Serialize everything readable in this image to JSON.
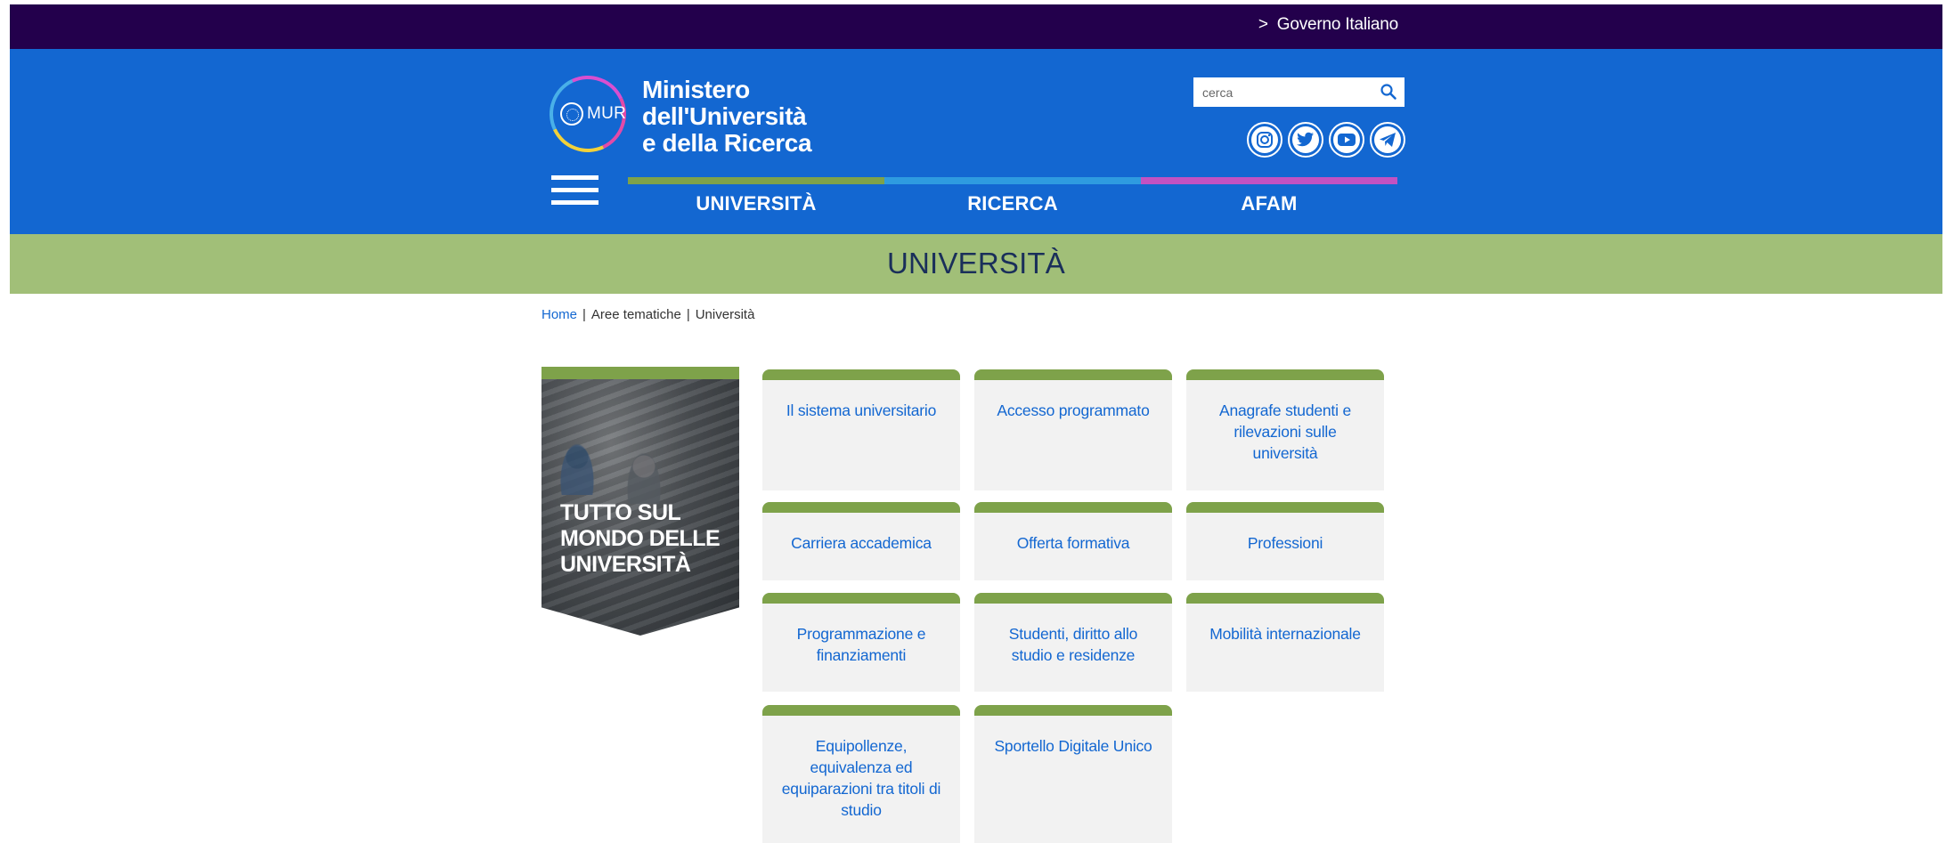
{
  "topbar": {
    "link_label": "Governo Italiano",
    "chevron": ">"
  },
  "header": {
    "logo_text": "MUR",
    "ministry_name_line1": "Ministero",
    "ministry_name_line2": "dell'Università",
    "ministry_name_line3": "e della Ricerca",
    "search": {
      "placeholder": "cerca",
      "icon": "search-icon"
    },
    "social": [
      {
        "name": "instagram-icon"
      },
      {
        "name": "twitter-icon"
      },
      {
        "name": "youtube-icon"
      },
      {
        "name": "telegram-icon"
      }
    ],
    "nav": [
      {
        "label": "UNIVERSITÀ",
        "color": "#7ea24a"
      },
      {
        "label": "RICERCA",
        "color": "#2e9be0"
      },
      {
        "label": "AFAM",
        "color": "#c252c2"
      }
    ]
  },
  "banner": {
    "title": "UNIVERSITÀ"
  },
  "breadcrumb": {
    "home": "Home",
    "separator": "|",
    "item2": "Aree tematiche",
    "item3": "Università"
  },
  "hero": {
    "title_line1": "TUTTO SUL",
    "title_line2": "MONDO DELLE",
    "title_line3": "UNIVERSITÀ"
  },
  "tiles": [
    {
      "label": "Il sistema universitario"
    },
    {
      "label": "Accesso programmato"
    },
    {
      "label": "Anagrafe studenti e rilevazioni sulle università"
    },
    {
      "label": "Carriera accademica"
    },
    {
      "label": "Offerta formativa"
    },
    {
      "label": "Professioni"
    },
    {
      "label": "Programmazione e finanziamenti"
    },
    {
      "label": "Studenti, diritto allo studio e residenze"
    },
    {
      "label": "Mobilità internazionale"
    },
    {
      "label": "Equipollenze, equivalenza ed equiparazioni tra titoli di studio"
    },
    {
      "label": "Sportello Digitale Unico"
    }
  ],
  "colors": {
    "topbar": "#23004c",
    "header": "#1367d1",
    "banner": "#a1bf78",
    "tile_accent": "#7ea24a",
    "link": "#1367d1"
  }
}
